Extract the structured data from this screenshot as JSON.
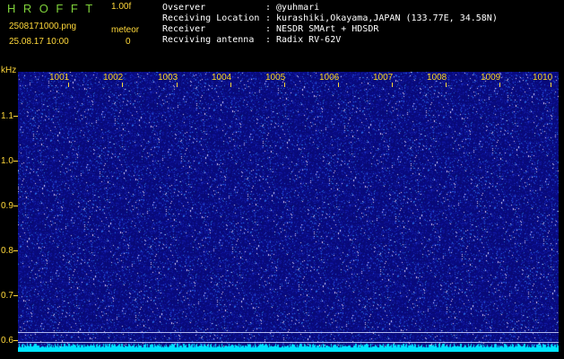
{
  "header": {
    "app_title": "HROFFT",
    "version": "1.00f",
    "filename": "2508171000.png",
    "datetime": "25.08.17 10:00",
    "meteor_label": "meteor",
    "meteor_count": "0"
  },
  "info": {
    "observer_label": "Ovserver",
    "observer_value": "@yuhmari",
    "location_label": "Receiving Location",
    "location_value": "kurashiki,Okayama,JAPAN (133.77E, 34.58N)",
    "receiver_label": "Receiver",
    "receiver_value": "NESDR SMArt + HDSDR",
    "antenna_label": "Recviving antenna",
    "antenna_value": "Radix RV-62V",
    "separator": ":"
  },
  "axis": {
    "y_unit": "kHz",
    "y_ticks": [
      "1.1",
      "1.0",
      "0.9",
      "0.8",
      "0.7",
      "0.6"
    ],
    "x_ticks": [
      "1001",
      "1002",
      "1003",
      "1004",
      "1005",
      "1006",
      "1007",
      "1008",
      "1009",
      "1010"
    ]
  },
  "colors": {
    "background": "#000000",
    "waterfall_base": "#0b0b7a",
    "title_green": "#7fd23a",
    "label_yellow": "#ffd83a",
    "noise_cyan": "#00e5ff"
  }
}
